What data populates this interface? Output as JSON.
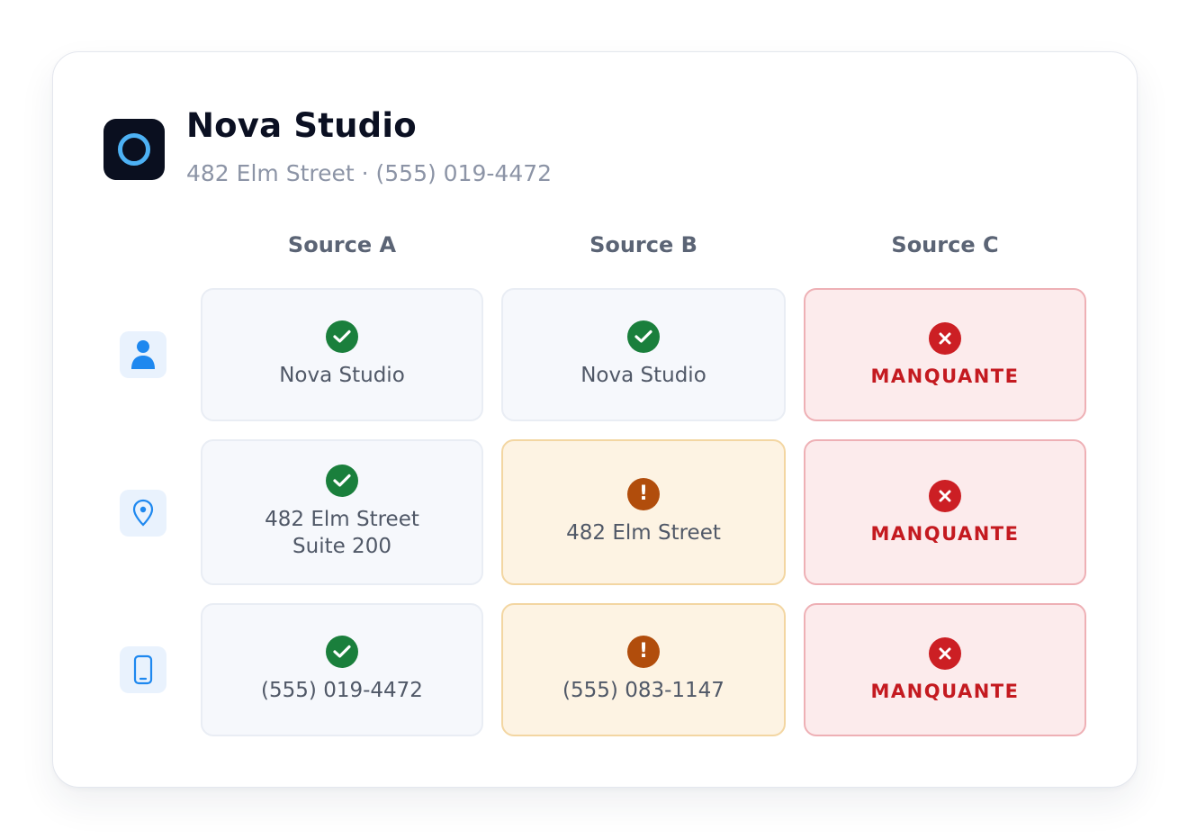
{
  "business": {
    "name": "Nova Studio",
    "subtitle": "482 Elm Street · (555) 019-4472",
    "logo_icon": "ring-logo-icon",
    "logo_accent": "#4db1f4"
  },
  "columns": [
    {
      "label": "Source A"
    },
    {
      "label": "Source B"
    },
    {
      "label": "Source C"
    }
  ],
  "rows": [
    {
      "icon": "person-icon",
      "cells": [
        {
          "status": "ok",
          "text": "Nova Studio"
        },
        {
          "status": "ok",
          "text": "Nova Studio"
        },
        {
          "status": "missing",
          "text": "MANQUANTE"
        }
      ]
    },
    {
      "icon": "location-pin-icon",
      "cells": [
        {
          "status": "ok",
          "text": "482 Elm Street\nSuite 200"
        },
        {
          "status": "warning",
          "text": "482 Elm Street"
        },
        {
          "status": "missing",
          "text": "MANQUANTE"
        }
      ]
    },
    {
      "icon": "phone-icon",
      "cells": [
        {
          "status": "ok",
          "text": "(555) 019-4472"
        },
        {
          "status": "warning",
          "text": "(555) 083-1147"
        },
        {
          "status": "missing",
          "text": "MANQUANTE"
        }
      ]
    }
  ],
  "colors": {
    "ok": "#1a7f3c",
    "warning": "#b14d0c",
    "missing": "#cc1f24",
    "icon_accent": "#1e88ef"
  }
}
